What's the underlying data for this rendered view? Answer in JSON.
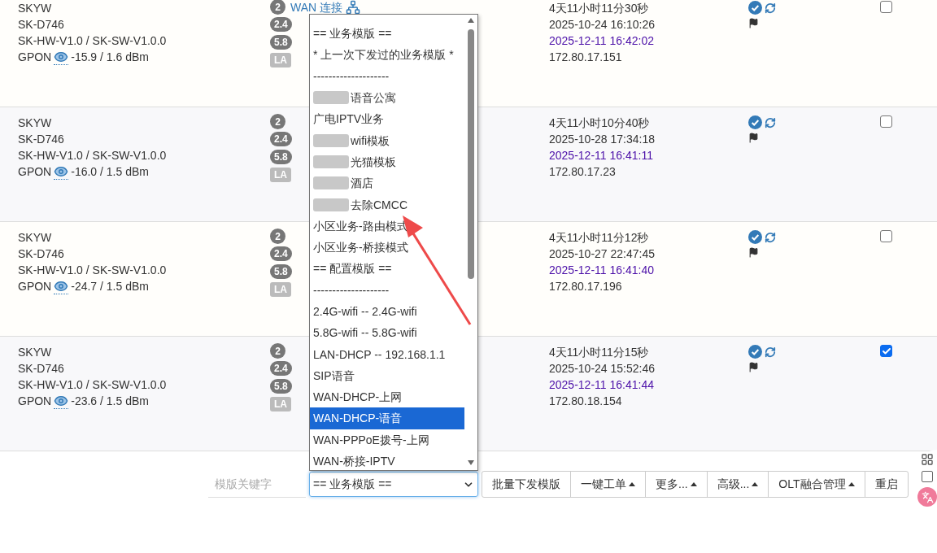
{
  "rows": [
    {
      "name": "SKYW",
      "model": "SK-D746",
      "version": "SK-HW-V1.0 / SK-SW-V1.0.0",
      "pon": "GPON",
      "optical": "-15.9 / 1.6 dBm",
      "count": "2",
      "link": "WAN 连接",
      "badges": [
        "2.4",
        "5.8",
        "LA"
      ],
      "uptime": "4天11小时11分30秒",
      "created": "2025-10-24 16:10:26",
      "last_seen": "2025-12-11 16:42:02",
      "ip": "172.80.17.151",
      "checked": false
    },
    {
      "name": "SKYW",
      "model": "SK-D746",
      "version": "SK-HW-V1.0 / SK-SW-V1.0.0",
      "pon": "GPON",
      "optical": "-16.0 / 1.5 dBm",
      "count": "2",
      "badges": [
        "2.4",
        "5.8",
        "LA"
      ],
      "uptime": "4天11小时10分40秒",
      "created": "2025-10-28 17:34:18",
      "last_seen": "2025-12-11 16:41:11",
      "ip": "172.80.17.23",
      "checked": false
    },
    {
      "name": "SKYW",
      "model": "SK-D746",
      "version": "SK-HW-V1.0 / SK-SW-V1.0.0",
      "pon": "GPON",
      "optical": "-24.7 / 1.5 dBm",
      "count": "2",
      "badges": [
        "2.4",
        "5.8",
        "LA"
      ],
      "uptime": "4天11小时11分12秒",
      "created": "2025-10-27 22:47:45",
      "last_seen": "2025-12-11 16:41:40",
      "ip": "172.80.17.196",
      "checked": false
    },
    {
      "name": "SKYW",
      "model": "SK-D746",
      "version": "SK-HW-V1.0 / SK-SW-V1.0.0",
      "pon": "GPON",
      "optical": "-23.6 / 1.5 dBm",
      "count": "2",
      "badges": [
        "2.4",
        "5.8",
        "LA"
      ],
      "uptime": "4天11小时11分15秒",
      "created": "2025-10-24 15:52:46",
      "last_seen": "2025-12-11 16:41:44",
      "ip": "172.80.18.154",
      "checked": true
    }
  ],
  "dropdown": {
    "options": [
      {
        "label": "== 业务模版 ==",
        "selected": false,
        "redacted": false
      },
      {
        "label": "* 上一次下发过的业务模版 *",
        "selected": false,
        "redacted": false
      },
      {
        "label": "--------------------",
        "selected": false,
        "redacted": false
      },
      {
        "label": "语音公寓",
        "selected": false,
        "redacted": true
      },
      {
        "label": "广电IPTV业务",
        "selected": false,
        "redacted": false
      },
      {
        "label": "wifi模板",
        "selected": false,
        "redacted": true
      },
      {
        "label": "光猫模板",
        "selected": false,
        "redacted": true
      },
      {
        "label": "酒店",
        "selected": false,
        "redacted": true
      },
      {
        "label": "去除CMCC",
        "selected": false,
        "redacted": true
      },
      {
        "label": "小区业务-路由模式",
        "selected": false,
        "redacted": false
      },
      {
        "label": "小区业务-桥接模式",
        "selected": false,
        "redacted": false
      },
      {
        "label": "== 配置模版 ==",
        "selected": false,
        "redacted": false
      },
      {
        "label": "--------------------",
        "selected": false,
        "redacted": false
      },
      {
        "label": "2.4G-wifi -- 2.4G-wifi",
        "selected": false,
        "redacted": false
      },
      {
        "label": "5.8G-wifi -- 5.8G-wifi",
        "selected": false,
        "redacted": false
      },
      {
        "label": "LAN-DHCP -- 192.168.1.1",
        "selected": false,
        "redacted": false
      },
      {
        "label": "SIP语音",
        "selected": false,
        "redacted": false
      },
      {
        "label": "WAN-DHCP-上网",
        "selected": false,
        "redacted": false
      },
      {
        "label": "WAN-DHCP-语音",
        "selected": true,
        "redacted": false
      },
      {
        "label": "WAN-PPPoE拨号-上网",
        "selected": false,
        "redacted": false
      },
      {
        "label": "WAN-桥接-IPTV",
        "selected": false,
        "redacted": false
      }
    ]
  },
  "side_panel": {
    "checked": false
  },
  "toolbar": {
    "keyword_placeholder": "模版关键字",
    "select_value": "== 业务模版 ==",
    "buttons": [
      {
        "label": "批量下发模版",
        "kind": "plain"
      },
      {
        "label": "一键工单",
        "kind": "dropdown"
      },
      {
        "label": "更多...",
        "kind": "dropdown"
      },
      {
        "label": "高级...",
        "kind": "dropdown"
      },
      {
        "label": "OLT融合管理",
        "kind": "dropdown"
      },
      {
        "label": "重启",
        "kind": "plain"
      }
    ]
  }
}
